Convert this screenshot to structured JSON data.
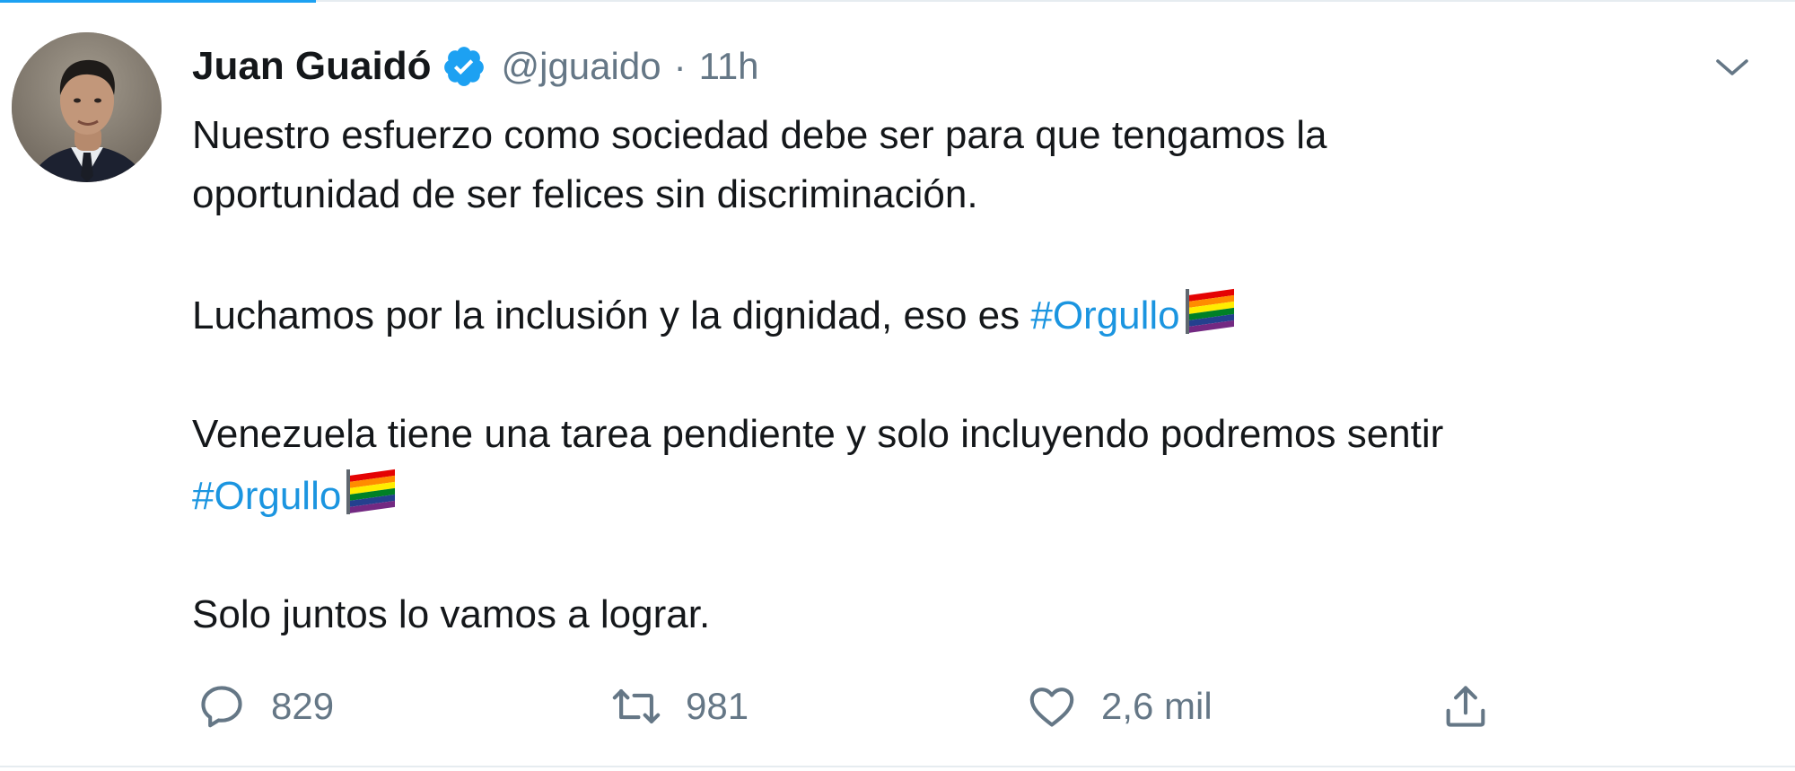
{
  "tweet": {
    "author": {
      "name": "Juan Guaidó",
      "handle": "@jguaido",
      "separator": "·",
      "time": "11h",
      "avatar_icon": "profile-photo"
    },
    "verified_icon": "verified-badge-icon",
    "menu_icon": "chevron-down-icon",
    "text": {
      "line1": "Nuestro esfuerzo como sociedad debe ser para que tengamos la",
      "line2": "oportunidad de ser felices sin discriminación.",
      "para2_text": "Luchamos por la inclusión y la dignidad, eso es ",
      "para2_hashtag": "#Orgullo",
      "para3_text": "Venezuela tiene una tarea pendiente y solo incluyendo podremos sentir",
      "para3_hashtag": "#Orgullo",
      "para4": "Solo juntos lo vamos a lograr.",
      "flag_emoji": "rainbow-flag"
    },
    "actions": {
      "reply_count": "829",
      "retweet_count": "981",
      "like_count": "2,6 mil",
      "reply_icon": "reply-icon",
      "retweet_icon": "retweet-icon",
      "like_icon": "heart-icon",
      "share_icon": "share-icon"
    }
  },
  "colors": {
    "accent": "#1da1f2",
    "hashtag": "#1b95e0",
    "text": "#14171a",
    "secondary": "#657786"
  }
}
